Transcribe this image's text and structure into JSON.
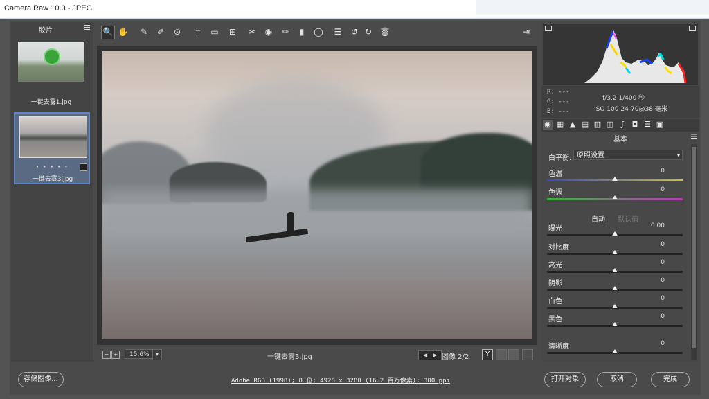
{
  "window": {
    "title": "Camera Raw 10.0 -  JPEG"
  },
  "filmstrip": {
    "title": "胶片",
    "items": [
      {
        "label": "一键去雾1.jpg",
        "selected": false
      },
      {
        "label": "一键去雾3.jpg",
        "selected": true,
        "rating": "• • • • •"
      }
    ]
  },
  "toolbar": {
    "tools": [
      {
        "name": "zoom-tool",
        "glyph": "🔍",
        "active": true
      },
      {
        "name": "hand-tool",
        "glyph": "✋"
      },
      {
        "name": "white-balance-tool",
        "glyph": "✎"
      },
      {
        "name": "color-sampler-tool",
        "glyph": "✐"
      },
      {
        "name": "targeted-adjustment-tool",
        "glyph": "⊙"
      },
      {
        "name": "crop-tool",
        "glyph": "⌗"
      },
      {
        "name": "straighten-tool",
        "glyph": "▭"
      },
      {
        "name": "transform-tool",
        "glyph": "⊞"
      },
      {
        "name": "spot-removal-tool",
        "glyph": "✂"
      },
      {
        "name": "red-eye-tool",
        "glyph": "◉"
      },
      {
        "name": "adjustment-brush",
        "glyph": "✏"
      },
      {
        "name": "graduated-filter",
        "glyph": "▮"
      },
      {
        "name": "radial-filter",
        "glyph": "◯"
      },
      {
        "name": "preferences",
        "glyph": "☰"
      },
      {
        "name": "rotate-left",
        "glyph": "↺"
      },
      {
        "name": "rotate-right",
        "glyph": "↻"
      },
      {
        "name": "delete",
        "glyph": "🗑"
      }
    ]
  },
  "preview": {
    "zoom": "15.6%",
    "filename": "一键去雾3.jpg",
    "image_count": "图像 2/2",
    "y_button": "Y"
  },
  "histogram": {
    "r": "R: ---",
    "g": "G: ---",
    "b": "B: ---",
    "exif1": "f/3.2  1/400 秒",
    "exif2": "ISO 100  24-70@38 毫米"
  },
  "panel": {
    "title": "基本",
    "wb_label": "白平衡:",
    "wb_value": "原照设置",
    "temp": {
      "label": "色温",
      "value": "0"
    },
    "tint": {
      "label": "色调",
      "value": "0"
    },
    "auto": "自动",
    "default": "默认值",
    "sliders": [
      {
        "label": "曝光",
        "value": "0.00"
      },
      {
        "label": "对比度",
        "value": "0"
      },
      {
        "label": "高光",
        "value": "0"
      },
      {
        "label": "阴影",
        "value": "0"
      },
      {
        "label": "白色",
        "value": "0"
      },
      {
        "label": "黑色",
        "value": "0"
      },
      {
        "label": "清晰度",
        "value": "0"
      }
    ]
  },
  "footer": {
    "save": "存储图像...",
    "workflow": "Adobe RGB (1998); 8 位; 4928 x 3280 (16.2 百万像素); 300 ppi",
    "open": "打开对象",
    "cancel": "取消",
    "done": "完成"
  },
  "colors": {
    "accent": "#5f86c8",
    "panel": "#484848",
    "background": "#535353"
  }
}
